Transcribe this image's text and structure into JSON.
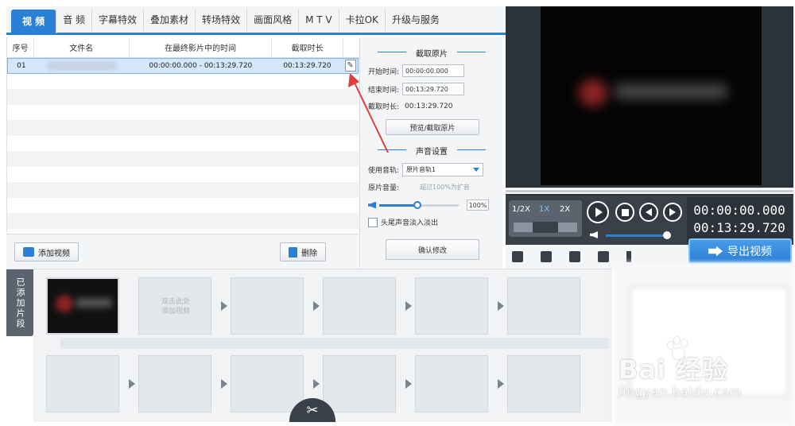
{
  "tabs": [
    {
      "label": "视 频",
      "active": true
    },
    {
      "label": "音 频"
    },
    {
      "label": "字幕特效"
    },
    {
      "label": "叠加素材"
    },
    {
      "label": "转场特效"
    },
    {
      "label": "画面风格"
    },
    {
      "label": "M T V"
    },
    {
      "label": "卡拉OK"
    },
    {
      "label": "升级与服务"
    }
  ],
  "table": {
    "headers": {
      "index": "序号",
      "filename": "文件名",
      "range": "在最终影片中的时间",
      "duration": "截取时长"
    },
    "rows": [
      {
        "index": "01",
        "range": "00:00:00.000 - 00:13:29.720",
        "duration": "00:13:29.720",
        "edit_icon": "pencil-icon"
      }
    ]
  },
  "left_buttons": {
    "add": "添加视频",
    "delete": "删除"
  },
  "trim": {
    "section_title": "截取原片",
    "start_label": "开始时间:",
    "start_value": "00:00:00.000",
    "end_label": "结束时间:",
    "end_value": "00:13:29.720",
    "duration_label": "截取时长:",
    "duration_value": "00:13:29.720",
    "preview_button": "预览/截取原片"
  },
  "sound": {
    "section_title": "声音设置",
    "track_label": "使用音轨:",
    "track_value": "原片音轨1",
    "volume_label": "原片音量:",
    "volume_hint": "超过100%为扩音",
    "volume_level": 0.48,
    "volume_percent": "100%",
    "fade_label": "头尾声音淡入淡出",
    "confirm_button": "确认修改"
  },
  "player": {
    "speeds": [
      "1/2X",
      "1X",
      "2X"
    ],
    "current_speed": "1X",
    "timecode_current": "00:00:00.000",
    "timecode_total": "00:13:29.720",
    "export_button": "导出视频"
  },
  "clips": {
    "side_label": "已添加片段",
    "empty_hint_line1": "双击此处",
    "empty_hint_line2": "添加视频"
  },
  "watermark": {
    "brand": "Bai  经验",
    "url": "jingyan.baidu.com"
  },
  "colors": {
    "accent": "#2a7fd6",
    "annotation": "#e03c3c"
  }
}
